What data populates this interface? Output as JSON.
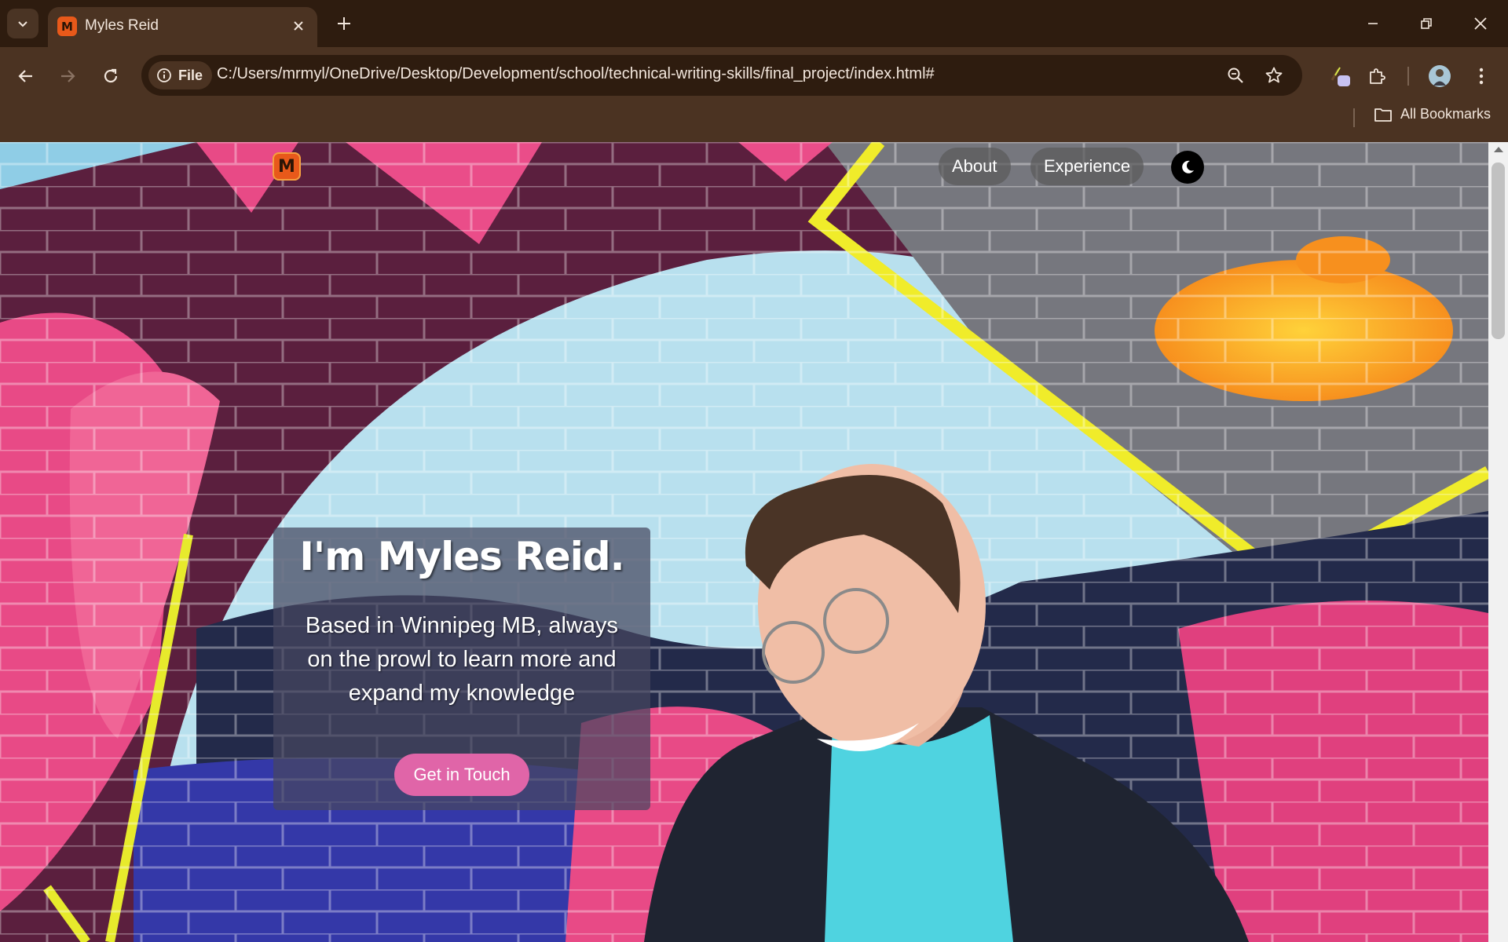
{
  "browser": {
    "tab": {
      "title": "Myles Reid",
      "favicon_letter": "M"
    },
    "address": {
      "scheme_chip": "File",
      "url": "C:/Users/mrmyl/OneDrive/Desktop/Development/school/technical-writing-skills/final_project/index.html#"
    },
    "bookmarks_label": "All Bookmarks",
    "icons": [
      "tab-search-icon",
      "close-icon",
      "plus-icon",
      "minimize-icon",
      "restore-icon",
      "close-icon",
      "back-arrow-icon",
      "forward-arrow-icon",
      "reload-icon",
      "info-icon",
      "zoom-icon",
      "star-icon",
      "extension-icon",
      "puzzle-icon",
      "profile-avatar",
      "kebab-menu-icon",
      "folder-icon"
    ]
  },
  "site": {
    "logo_letter": "M",
    "nav": {
      "about": "About",
      "experience": "Experience"
    },
    "theme_toggle_icon": "moon-icon",
    "hero": {
      "title": "I'm Myles Reid.",
      "text": "Based in Winnipeg MB, always on the prowl to learn more and expand my knowledge",
      "cta": "Get in Touch"
    },
    "colors": {
      "accent": "#e065a8",
      "logo": "#e8591a"
    }
  }
}
